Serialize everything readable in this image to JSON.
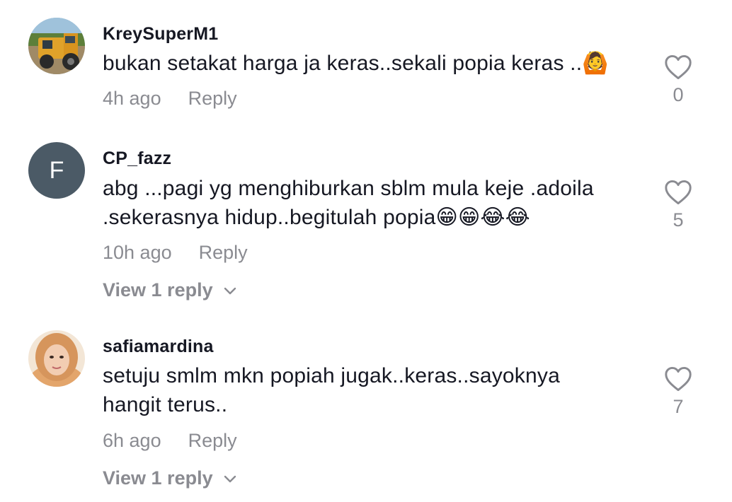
{
  "comments": [
    {
      "username": "KreySuperM1",
      "avatar_icon": "excavator-photo",
      "text": "bukan setakat harga ja keras..sekali popia keras ..",
      "emoji": "🙆",
      "time": "4h ago",
      "reply_label": "Reply",
      "likes": "0"
    },
    {
      "username": "CP_fazz",
      "avatar_letter": "F",
      "text": "abg ...pagi yg menghiburkan sblm mula keje .adoila .sekerasnya hidup..begitulah popia",
      "emoji": "😁😁😂😂",
      "time": "10h ago",
      "reply_label": "Reply",
      "view_replies": "View 1 reply",
      "likes": "5"
    },
    {
      "username": "safiamardina",
      "avatar_icon": "profile-photo",
      "text": "setuju smlm mkn popiah jugak..keras..sayoknya hangit terus..",
      "time": "6h ago",
      "reply_label": "Reply",
      "view_replies": "View 1 reply",
      "likes": "7"
    }
  ],
  "colors": {
    "text": "#161823",
    "secondary": "#8a8b91",
    "avatar_letter_bg": "#4b5a66"
  }
}
